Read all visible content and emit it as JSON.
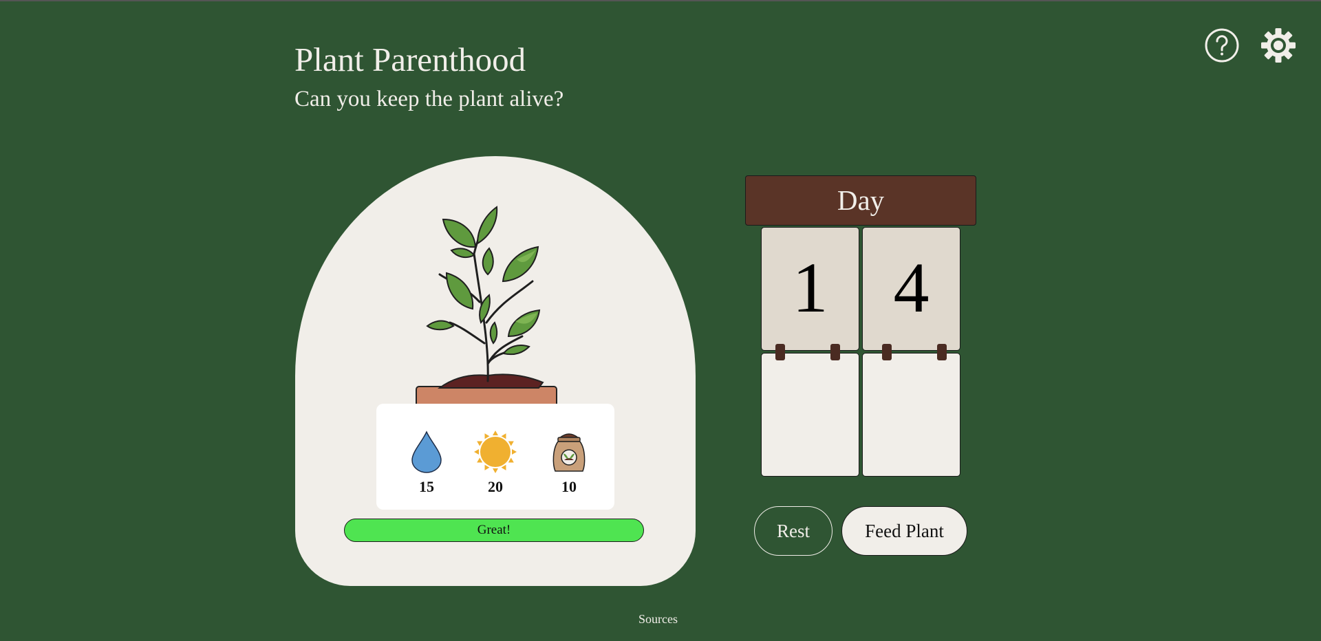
{
  "header": {
    "title": "Plant Parenthood",
    "subtitle": "Can you keep the plant alive?"
  },
  "top_icons": {
    "help_icon": "question-mark-circle-icon",
    "settings_icon": "gear-icon"
  },
  "plant": {
    "stats": [
      {
        "name": "water",
        "icon": "water-drop-icon",
        "value": "15",
        "color": "#5b9bd5"
      },
      {
        "name": "sun",
        "icon": "sun-icon",
        "value": "20",
        "color": "#f0b030"
      },
      {
        "name": "fertilizer",
        "icon": "fertilizer-bag-icon",
        "value": "10",
        "color": "#c9a07a"
      }
    ],
    "status_label": "Great!",
    "status_color": "#4fe451"
  },
  "calendar": {
    "header": "Day",
    "digits": [
      "1",
      "4"
    ]
  },
  "actions": {
    "rest_label": "Rest",
    "feed_label": "Feed Plant"
  },
  "footer": {
    "sources_label": "Sources"
  },
  "colors": {
    "background": "#2f5533",
    "panel": "#f1eee9",
    "calendar_header": "#5a3427"
  }
}
